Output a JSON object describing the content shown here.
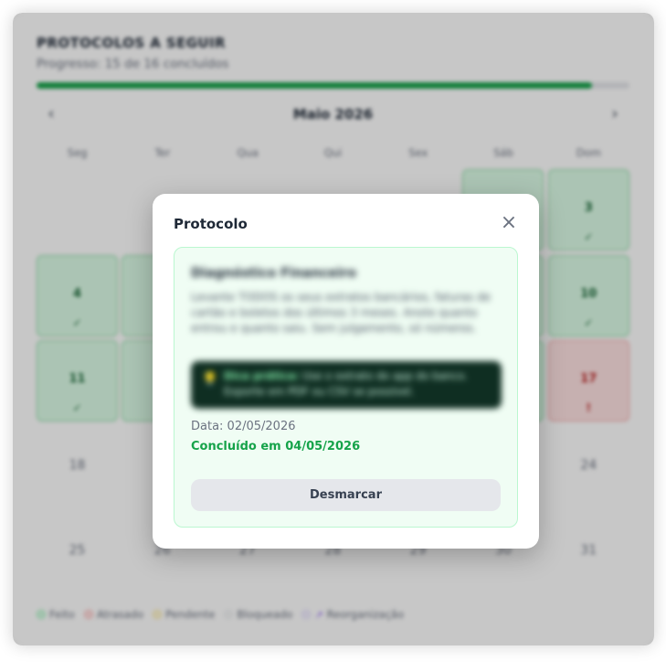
{
  "header": {
    "title": "PROTOCOLOS A SEGUIR",
    "progress_text": "Progresso: 15 de 16 concluídos",
    "progress_fraction": 0.9375
  },
  "calendar": {
    "month_label": "Maio 2026",
    "prev_icon": "‹",
    "next_icon": "›",
    "weekdays": [
      "Seg",
      "Ter",
      "Qua",
      "Qui",
      "Sex",
      "Sáb",
      "Dom"
    ],
    "weeks": [
      [
        {
          "day": "",
          "state": "empty",
          "mark": ""
        },
        {
          "day": "",
          "state": "empty",
          "mark": ""
        },
        {
          "day": "",
          "state": "empty",
          "mark": ""
        },
        {
          "day": "",
          "state": "empty",
          "mark": ""
        },
        {
          "day": "",
          "state": "empty",
          "mark": ""
        },
        {
          "day": "",
          "state": "done",
          "mark": ""
        },
        {
          "day": "3",
          "state": "done",
          "mark": "✓"
        }
      ],
      [
        {
          "day": "4",
          "state": "done",
          "mark": "✓"
        },
        {
          "day": "",
          "state": "done",
          "mark": ""
        },
        {
          "day": "",
          "state": "empty",
          "mark": ""
        },
        {
          "day": "",
          "state": "empty",
          "mark": ""
        },
        {
          "day": "",
          "state": "empty",
          "mark": ""
        },
        {
          "day": "",
          "state": "done",
          "mark": ""
        },
        {
          "day": "10",
          "state": "done",
          "mark": "✓"
        }
      ],
      [
        {
          "day": "11",
          "state": "done",
          "mark": "✓"
        },
        {
          "day": "",
          "state": "done",
          "mark": ""
        },
        {
          "day": "",
          "state": "empty",
          "mark": ""
        },
        {
          "day": "",
          "state": "empty",
          "mark": ""
        },
        {
          "day": "",
          "state": "empty",
          "mark": ""
        },
        {
          "day": "",
          "state": "done",
          "mark": ""
        },
        {
          "day": "17",
          "state": "late",
          "mark": "!"
        }
      ],
      [
        {
          "day": "18",
          "state": "plain",
          "mark": ""
        },
        {
          "day": "",
          "state": "empty",
          "mark": ""
        },
        {
          "day": "",
          "state": "empty",
          "mark": ""
        },
        {
          "day": "",
          "state": "empty",
          "mark": ""
        },
        {
          "day": "",
          "state": "empty",
          "mark": ""
        },
        {
          "day": "",
          "state": "empty",
          "mark": ""
        },
        {
          "day": "24",
          "state": "plain",
          "mark": ""
        }
      ],
      [
        {
          "day": "25",
          "state": "plain",
          "mark": ""
        },
        {
          "day": "26",
          "state": "plain",
          "mark": ""
        },
        {
          "day": "27",
          "state": "plain",
          "mark": ""
        },
        {
          "day": "28",
          "state": "plain",
          "mark": ""
        },
        {
          "day": "29",
          "state": "plain",
          "mark": ""
        },
        {
          "day": "30",
          "state": "plain",
          "mark": ""
        },
        {
          "day": "31",
          "state": "plain",
          "mark": ""
        }
      ]
    ]
  },
  "legend": [
    {
      "label": "Feito",
      "color": "#86efac",
      "icon": "circle"
    },
    {
      "label": "Atrasado",
      "color": "#fca5a5",
      "icon": "circle"
    },
    {
      "label": "Pendente",
      "color": "#fde68a",
      "icon": "circle"
    },
    {
      "label": "Bloqueado",
      "color": "#e5e7eb",
      "icon": "circle"
    },
    {
      "label": "Reorganização",
      "color": "#ddd6fe",
      "icon": "trend-icon"
    }
  ],
  "modal": {
    "title": "Protocolo",
    "close_icon": "×",
    "item_title": "Diagnóstico Financeiro",
    "item_description": "Levante TODOS os seus extratos bancários, faturas de cartão e boletos dos últimos 3 meses. Anote quanto entrou e quanto saiu. Sem julgamento, só números.",
    "tip_icon": "💡",
    "tip_strong": "Dica prática:",
    "tip_text": " Use o extrato do app do banco. Exporte em PDF ou CSV se possível.",
    "date_text": "Data: 02/05/2026",
    "completed_text": "Concluído em 04/05/2026",
    "unmark_label": "Desmarcar"
  },
  "colors": {
    "accent_green": "#16a34a",
    "late_red": "#b91c1c"
  }
}
